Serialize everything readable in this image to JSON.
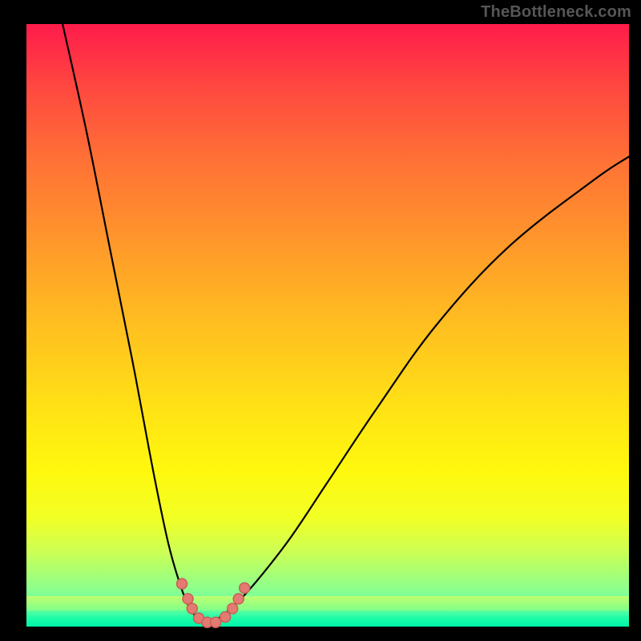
{
  "watermark": "TheBottleneck.com",
  "colors": {
    "curve": "#000000",
    "marker_fill": "#e47b73",
    "marker_stroke": "#c85e56"
  },
  "chart_data": {
    "type": "line",
    "title": "",
    "xlabel": "",
    "ylabel": "",
    "xlim": [
      0,
      100
    ],
    "ylim": [
      0,
      100
    ],
    "MAIN_CURVES_NOTE": "Two curve branches forming a V/valley. y is visual height where 0=bottom, 100=top. No axis ticks shown in source image; values are approximate screen-space percentages.",
    "curve_left": {
      "x": [
        6,
        10,
        14,
        18,
        21,
        23.5,
        25.5,
        27,
        28.2,
        29,
        29.8
      ],
      "y": [
        100,
        82,
        62,
        42,
        26,
        14,
        7,
        3.2,
        1.6,
        0.8,
        0.5
      ]
    },
    "curve_right": {
      "x": [
        29.8,
        31,
        33,
        35.5,
        39,
        44,
        50,
        58,
        68,
        80,
        94,
        100
      ],
      "y": [
        0.5,
        0.9,
        2.2,
        4.5,
        8.5,
        15,
        24,
        36,
        50,
        63,
        74,
        78
      ]
    },
    "markers": [
      {
        "x": 25.8,
        "y": 7.1
      },
      {
        "x": 26.8,
        "y": 4.6
      },
      {
        "x": 27.5,
        "y": 3.0
      },
      {
        "x": 28.6,
        "y": 1.4
      },
      {
        "x": 30.0,
        "y": 0.7
      },
      {
        "x": 31.4,
        "y": 0.7
      },
      {
        "x": 33.0,
        "y": 1.6
      },
      {
        "x": 34.2,
        "y": 3.0
      },
      {
        "x": 35.2,
        "y": 4.6
      },
      {
        "x": 36.2,
        "y": 6.4
      }
    ]
  }
}
